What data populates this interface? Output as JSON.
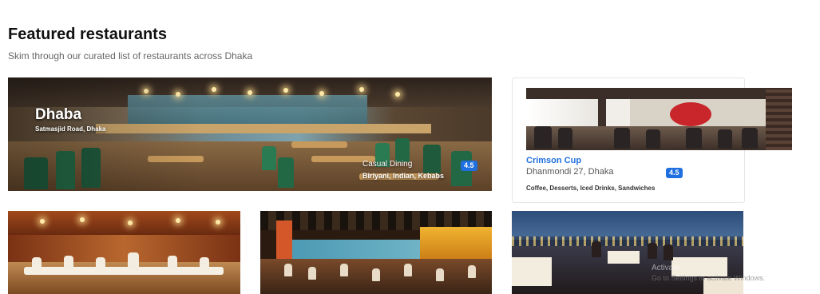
{
  "header": {
    "title": "Featured restaurants",
    "subtitle": "Skim through our curated list of restaurants across Dhaka"
  },
  "featured": {
    "name": "Dhaba",
    "location": "Satmasjid Road, Dhaka",
    "category": "Casual Dining",
    "rating": "4.5",
    "cuisines": "Biriyani, Indian, Kebabs"
  },
  "side_card": {
    "name": "Crimson Cup",
    "location": "Dhanmondi 27, Dhaka",
    "rating": "4.5",
    "cuisines": "Coffee, Desserts, Iced Drinks, Sandwiches"
  },
  "watermark": {
    "line1": "Activate",
    "line2": "Go to Settings to activate Windows."
  },
  "colors": {
    "accent": "#1f6fe0",
    "title": "#111111",
    "subtitle": "#666666"
  }
}
